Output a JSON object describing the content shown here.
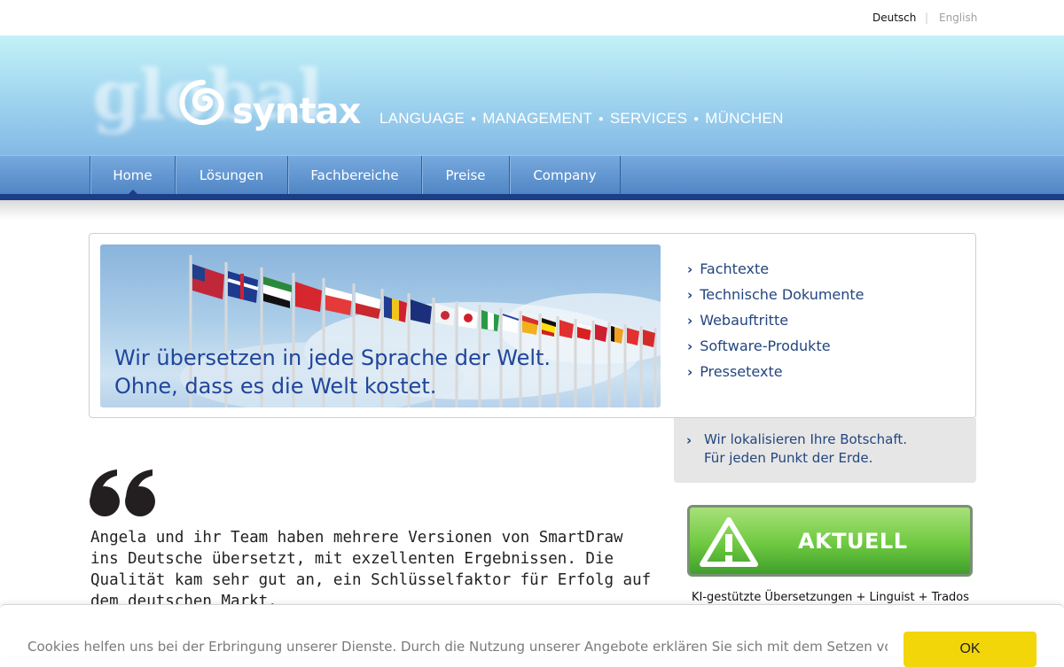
{
  "language": {
    "active": "Deutsch",
    "separator": "|",
    "other": "English"
  },
  "brand": {
    "ghost": "global",
    "name": "syntax",
    "tagline": [
      "LANGUAGE",
      "MANAGEMENT",
      "SERVICES",
      "MÜNCHEN"
    ]
  },
  "nav": {
    "items": [
      {
        "label": "Home"
      },
      {
        "label": "Lösungen"
      },
      {
        "label": "Fachbereiche"
      },
      {
        "label": "Preise"
      },
      {
        "label": "Company"
      }
    ],
    "active": "Home"
  },
  "banner": {
    "line1": "Wir übersetzen in jede Sprache der Welt.",
    "line2": "Ohne, dass es die Welt kostet."
  },
  "services": [
    "Fachtexte",
    "Technische Dokumente",
    "Webauftritte",
    "Software-Produkte",
    "Pressetexte"
  ],
  "localize": {
    "line1": "Wir lokalisieren Ihre Botschaft.",
    "line2": "Für jeden Punkt der Erde."
  },
  "quote": {
    "text": "Angela und ihr Team haben mehrere Versionen von SmartDraw ins Deutsche übersetzt, mit exzellenten Ergebnissen. Die Qualität kam sehr gut an, ein Schlüsselfaktor für Erfolg auf dem deutschen Markt."
  },
  "aktuell": {
    "label": "AKTUELL",
    "caption": "KI-gestützte Übersetzungen + Linguist + Trados"
  },
  "cookie": {
    "text": "Cookies helfen uns bei der Erbringung unserer Dienste. Durch die Nutzung unserer Angebote erklären Sie sich mit dem Setzen von Cookies",
    "button": "OK"
  },
  "colors": {
    "nav_dark": "#1c3e86",
    "link_blue": "#23467f",
    "banner_text": "#20469a",
    "cookie_button": "#f2d60a",
    "aktuell_green": "#6ec940"
  }
}
